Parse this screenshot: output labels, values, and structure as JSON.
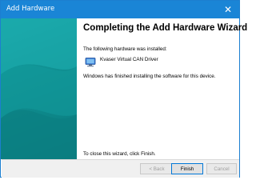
{
  "window": {
    "title": "Add Hardware",
    "close_glyph": "✕"
  },
  "wizard": {
    "heading": "Completing the Add Hardware Wizard",
    "installed_label": "The following hardware was installed:",
    "device_name": "Kvaser Virtual CAN Driver",
    "finished_message": "Windows has finished installing the software for this device.",
    "close_hint": "To close this wizard, click Finish."
  },
  "buttons": {
    "back": "< Back",
    "finish": "Finish",
    "cancel": "Cancel"
  },
  "colors": {
    "titlebar": "#1a85d6",
    "side_panel": "#0f8f91",
    "default_button_border": "#0078d7"
  }
}
